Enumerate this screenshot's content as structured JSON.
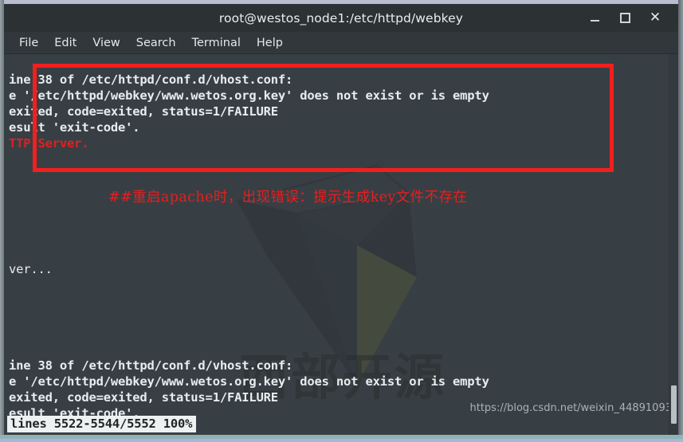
{
  "window": {
    "title": "root@westos_node1:/etc/httpd/webkey",
    "buttons": [
      {
        "name": "minimize",
        "label": "_"
      },
      {
        "name": "maximize",
        "label": "□"
      },
      {
        "name": "close",
        "label": "✕"
      }
    ]
  },
  "menubar": {
    "items": [
      "File",
      "Edit",
      "View",
      "Search",
      "Terminal",
      "Help"
    ]
  },
  "terminal": {
    "top_block": [
      {
        "text": "ine 38 of /etc/httpd/conf.d/vhost.conf:",
        "color": "white",
        "weight": "bold"
      },
      {
        "text": "e '/etc/httpd/webkey/www.wetos.org.key' does not exist or is empty",
        "color": "white",
        "weight": "bold"
      },
      {
        "text": "exited, code=exited, status=1/FAILURE",
        "color": "white",
        "weight": "bold"
      },
      {
        "text": "esult 'exit-code'.",
        "color": "white",
        "weight": "bold"
      },
      {
        "text": "TTP Server.",
        "color": "red",
        "weight": "bold"
      }
    ],
    "middle_text": "ver...",
    "bottom_block": [
      {
        "text": "ine 38 of /etc/httpd/conf.d/vhost.conf:",
        "color": "white",
        "weight": "bold"
      },
      {
        "text": "e '/etc/httpd/webkey/www.wetos.org.key' does not exist or is empty",
        "color": "white",
        "weight": "bold"
      },
      {
        "text": "exited, code=exited, status=1/FAILURE",
        "color": "white",
        "weight": "bold"
      },
      {
        "text": "esult 'exit-code'.",
        "color": "white",
        "weight": "bold"
      }
    ],
    "status_line": "lines 5522-5544/5552 100%"
  },
  "annotation": {
    "chinese_note": "##重启apache时，出现错误：提示生成key文件不存在",
    "highlight_color": "#f21f1f"
  },
  "watermark": {
    "logo_text": "西部开源",
    "url": "https://blog.csdn.net/weixin_44891093"
  },
  "colors": {
    "terminal_bg": "#383f44",
    "titlebar_bg": "#2c3133",
    "menubar_bg": "#31373a",
    "text": "#e8ecee",
    "red": "#e02020",
    "status_bg": "#eef1f2"
  }
}
